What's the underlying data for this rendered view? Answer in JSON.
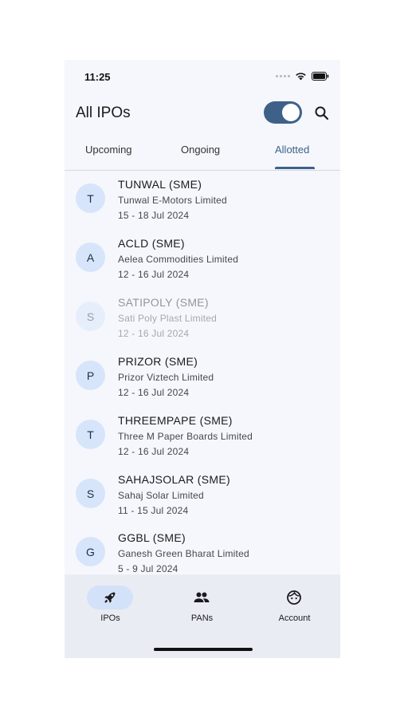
{
  "status_bar": {
    "time": "11:25"
  },
  "app_bar": {
    "title": "All IPOs"
  },
  "tabs": [
    {
      "label": "Upcoming",
      "active": false
    },
    {
      "label": "Ongoing",
      "active": false
    },
    {
      "label": "Allotted",
      "active": true
    }
  ],
  "ipos": [
    {
      "initial": "T",
      "symbol": "TUNWAL (SME)",
      "company": "Tunwal E-Motors Limited",
      "dates": "15 - 18 Jul 2024"
    },
    {
      "initial": "A",
      "symbol": "ACLD (SME)",
      "company": "Aelea Commodities Limited",
      "dates": "12 - 16 Jul 2024"
    },
    {
      "initial": "S",
      "symbol": "SATIPOLY (SME)",
      "company": "Sati Poly Plast Limited",
      "dates": "12 - 16 Jul 2024"
    },
    {
      "initial": "P",
      "symbol": "PRIZOR (SME)",
      "company": "Prizor Viztech Limited",
      "dates": "12 - 16 Jul 2024"
    },
    {
      "initial": "T",
      "symbol": "THREEMPAPE (SME)",
      "company": "Three M Paper Boards Limited",
      "dates": "12 - 16 Jul 2024"
    },
    {
      "initial": "S",
      "symbol": "SAHAJSOLAR (SME)",
      "company": "Sahaj Solar Limited",
      "dates": "11 - 15 Jul 2024"
    },
    {
      "initial": "G",
      "symbol": "GGBL (SME)",
      "company": "Ganesh Green Bharat Limited",
      "dates": "5 - 9 Jul 2024"
    }
  ],
  "bottom_nav": [
    {
      "label": "IPOs",
      "icon": "rocket-icon",
      "active": true
    },
    {
      "label": "PANs",
      "icon": "people-icon",
      "active": false
    },
    {
      "label": "Account",
      "icon": "face-icon",
      "active": false
    }
  ],
  "colors": {
    "accent": "#3e6189",
    "avatar_bg": "#d7e5fb",
    "nav_bg": "#e9edf3"
  }
}
